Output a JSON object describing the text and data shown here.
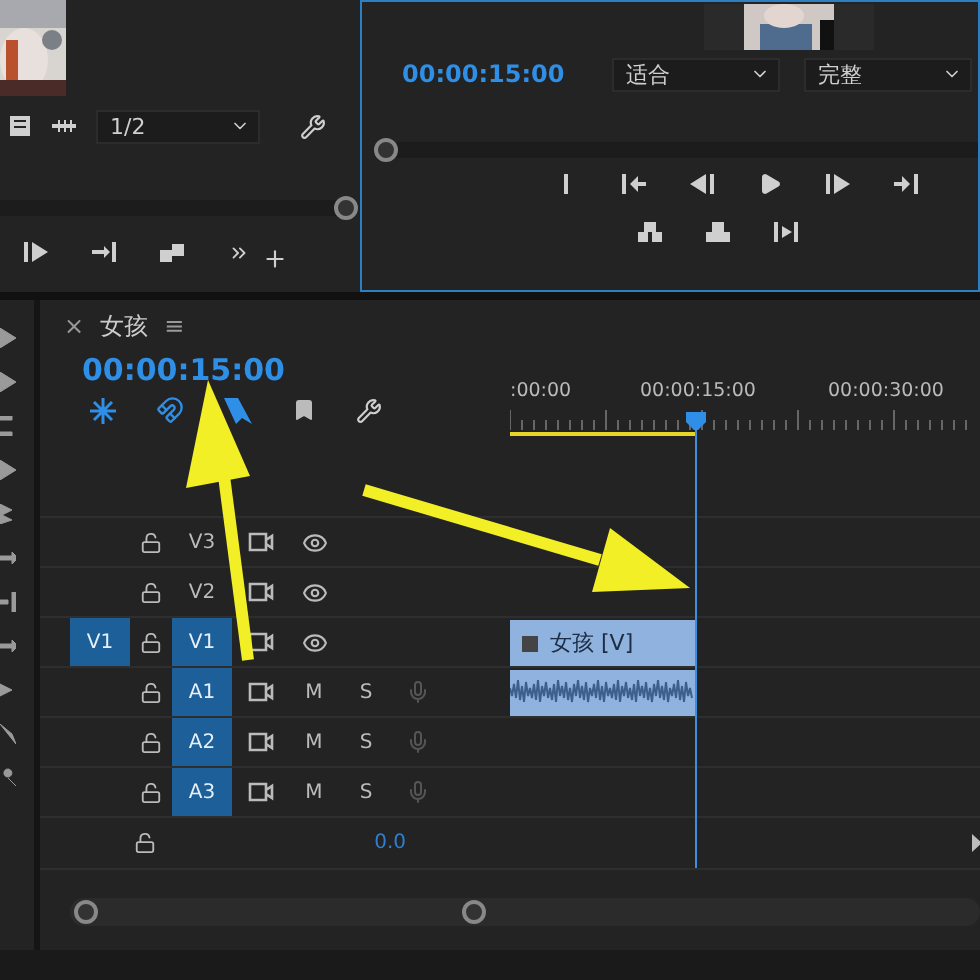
{
  "source_monitor": {
    "zoom": "1/2"
  },
  "program_monitor": {
    "timecode": "00:00:15:00",
    "fit": "适合",
    "quality": "完整"
  },
  "timeline": {
    "close": "×",
    "title": "女孩",
    "menu": "≡",
    "timecode": "00:00:15:00",
    "ruler_labels": [
      ":00:00",
      "00:00:15:00",
      "00:00:30:00"
    ],
    "tracks": [
      {
        "kind": "video",
        "label": "V3",
        "selected": false
      },
      {
        "kind": "video",
        "label": "V2",
        "selected": false
      },
      {
        "kind": "video",
        "label": "V1",
        "selected": true,
        "source_patch": {
          "label": "V1",
          "selected": true
        },
        "clip": {
          "kind": "video",
          "label": "女孩 [V]"
        }
      },
      {
        "kind": "audio",
        "label": "A1",
        "selected": true,
        "mute": "M",
        "solo": "S",
        "clip": {
          "kind": "audio"
        }
      },
      {
        "kind": "audio",
        "label": "A2",
        "selected": true,
        "mute": "M",
        "solo": "S"
      },
      {
        "kind": "audio",
        "label": "A3",
        "selected": true,
        "mute": "M",
        "solo": "S"
      }
    ],
    "master": {
      "volume": "0.0"
    }
  }
}
